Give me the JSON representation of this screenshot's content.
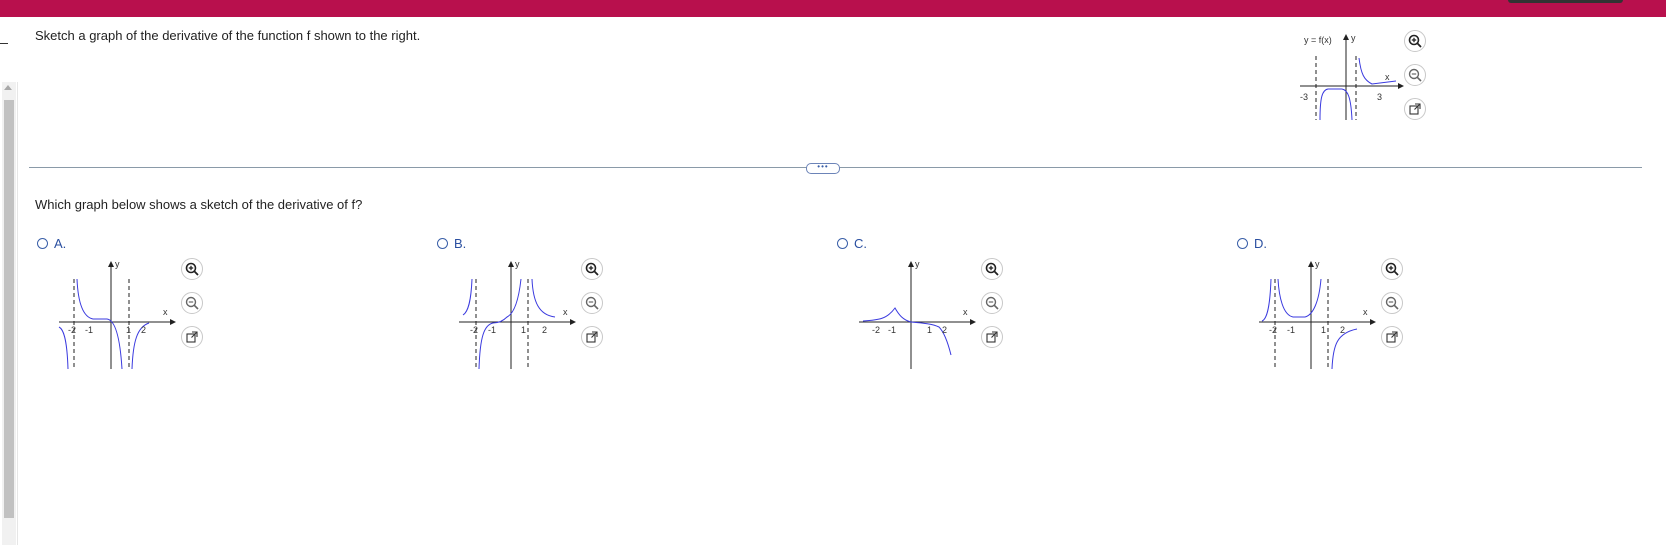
{
  "problem": {
    "prompt": "Sketch a graph of the derivative of the function f shown to the right.",
    "question": "Which graph below shows a sketch of the derivative of f?",
    "divider_handle": "•••"
  },
  "given_graph": {
    "function_label": "y = f(x)",
    "x_axis": "x",
    "y_axis": "y",
    "tick_labels": [
      "-3",
      "3"
    ]
  },
  "options": [
    {
      "letter": "A.",
      "ticks": [
        "-2",
        "-1",
        "1",
        "2"
      ],
      "x_axis": "x",
      "y_axis": "y"
    },
    {
      "letter": "B.",
      "ticks": [
        "-2",
        "-1",
        "1",
        "2"
      ],
      "x_axis": "x",
      "y_axis": "y"
    },
    {
      "letter": "C.",
      "ticks": [
        "-2",
        "-1",
        "1",
        "2"
      ],
      "x_axis": "x",
      "y_axis": "y"
    },
    {
      "letter": "D.",
      "ticks": [
        "-2",
        "-1",
        "1",
        "2"
      ],
      "x_axis": "x",
      "y_axis": "y"
    }
  ],
  "tools": [
    "zoom-in-icon",
    "zoom-out-icon",
    "open-external-icon"
  ],
  "colors": {
    "topbar": "#b8104d",
    "curve": "#3a3adf",
    "option_text": "#2a4fa0"
  }
}
